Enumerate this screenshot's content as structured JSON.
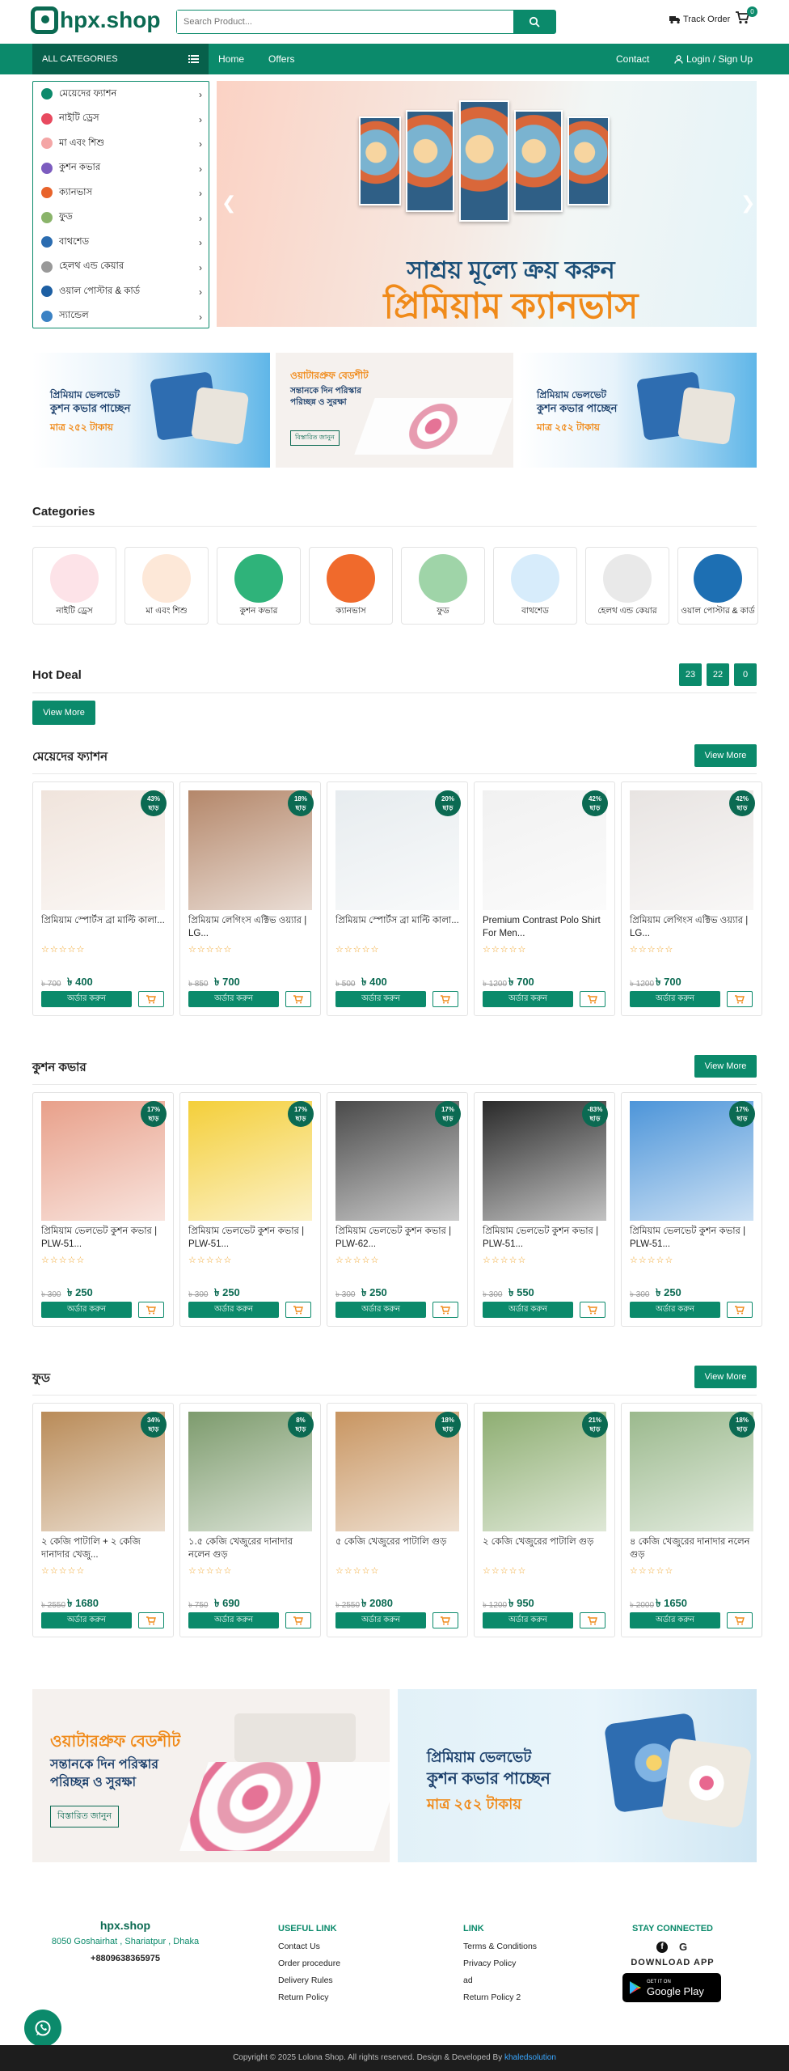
{
  "header": {
    "logo_text": "hpx.shop",
    "search_placeholder": "Search Product...",
    "track_order": "Track Order",
    "cart_count": "0"
  },
  "nav": {
    "all_categories": "ALL CATEGORIES",
    "links": [
      "Home",
      "Offers"
    ],
    "contact": "Contact",
    "login": "Login / Sign Up"
  },
  "sidebar": {
    "items": [
      {
        "label": "মেয়েদের ফ্যাশন",
        "icon": "fashion-icon",
        "color": "#0b8a6b"
      },
      {
        "label": "নাইটি ড্রেস",
        "icon": "dress-icon",
        "color": "#e84a5f"
      },
      {
        "label": "মা এবং শিশু",
        "icon": "baby-icon",
        "color": "#f4a6a6"
      },
      {
        "label": "কুশন কভার",
        "icon": "cushion-icon",
        "color": "#7c5cbf"
      },
      {
        "label": "ক্যানভাস",
        "icon": "canvas-icon",
        "color": "#e8632b"
      },
      {
        "label": "ফুড",
        "icon": "food-icon",
        "color": "#8ab46a"
      },
      {
        "label": "বাথশেড",
        "icon": "bath-icon",
        "color": "#2b6cb0"
      },
      {
        "label": "হেলথ এন্ড কেয়ার",
        "icon": "health-icon",
        "color": "#999999"
      },
      {
        "label": "ওয়াল পোস্টার & কার্ড",
        "icon": "poster-icon",
        "color": "#1d5fa3"
      },
      {
        "label": "স্যান্ডেল",
        "icon": "sandal-icon",
        "color": "#3b82c4"
      }
    ]
  },
  "hero": {
    "line1": "সাশ্রয় মূল্যে ক্রয় করুন",
    "line2": "প্রিমিয়াম ক্যানভাস"
  },
  "promos": [
    {
      "line1": "প্রিমিয়াম ভেলভেট",
      "line2": "কুশন কভার পাচ্ছেন",
      "line3": "মাত্র ২৫২ টাকায়"
    },
    {
      "line1": "ওয়াটারপ্রুফ বেডশীট",
      "line2": "সন্তানকে দিন পরিস্কার",
      "line3": "পরিচ্ছন্ন ও সুরক্ষা",
      "button": "বিস্তারিত জানুন"
    },
    {
      "line1": "প্রিমিয়াম ভেলভেট",
      "line2": "কুশন কভার পাচ্ছেন",
      "line3": "মাত্র ২৫২ টাকায়"
    }
  ],
  "categories": {
    "title": "Categories",
    "items": [
      {
        "label": "নাইটি ড্রেস",
        "color": "#fde3e8"
      },
      {
        "label": "মা এবং শিশু",
        "color": "#fde8d8"
      },
      {
        "label": "কুশন কভার",
        "color": "#2fb37a"
      },
      {
        "label": "ক্যানভাস",
        "color": "#f06a2c"
      },
      {
        "label": "ফুড",
        "color": "#9fd4a8"
      },
      {
        "label": "বাথশেড",
        "color": "#d7ecfb"
      },
      {
        "label": "হেলথ এন্ড কেয়ার",
        "color": "#e9e9e9"
      },
      {
        "label": "ওয়াল পোস্টার & কার্ড",
        "color": "#1d6fb3"
      }
    ]
  },
  "hot_deal": {
    "title": "Hot Deal",
    "countdown": [
      "23",
      "22",
      "0"
    ],
    "view_more": "View More"
  },
  "sections": [
    {
      "title": "মেয়েদের ফ্যাশন",
      "view_more": "View More",
      "products": [
        {
          "name": "প্রিমিয়াম স্পোর্টস ব্রা মাল্টি কালা...",
          "old": "৳ 700",
          "price": "৳ 400",
          "disc": "43%",
          "color": "#f0e4dc"
        },
        {
          "name": "প্রিমিয়াম লেগিংস এক্টিভ ওয়্যার | LG...",
          "old": "৳ 850",
          "price": "৳ 700",
          "disc": "18%",
          "color": "#b4876a"
        },
        {
          "name": "প্রিমিয়াম স্পোর্টস ব্রা মাল্টি কালা...",
          "old": "৳ 500",
          "price": "৳ 400",
          "disc": "20%",
          "color": "#e7ecef"
        },
        {
          "name": "Premium Contrast Polo Shirt For Men...",
          "old": "৳ 1200",
          "price": "৳ 700",
          "disc": "42%",
          "color": "#f1f1f1"
        },
        {
          "name": "প্রিমিয়াম লেগিংস এক্টিভ ওয়্যার | LG...",
          "old": "৳ 1200",
          "price": "৳ 700",
          "disc": "42%",
          "color": "#e8e4e2"
        }
      ]
    },
    {
      "title": "কুশন কভার",
      "view_more": "View More",
      "products": [
        {
          "name": "প্রিমিয়াম ভেলভেট কুশন কভার | PLW-51...",
          "old": "৳ 300",
          "price": "৳ 250",
          "disc": "17%",
          "color": "#e8a08a"
        },
        {
          "name": "প্রিমিয়াম ভেলভেট কুশন কভার | PLW-51...",
          "old": "৳ 300",
          "price": "৳ 250",
          "disc": "17%",
          "color": "#f4cf3a"
        },
        {
          "name": "প্রিমিয়াম ভেলভেট কুশন কভার | PLW-62...",
          "old": "৳ 300",
          "price": "৳ 250",
          "disc": "17%",
          "color": "#4a4a4a"
        },
        {
          "name": "প্রিমিয়াম ভেলভেট কুশন কভার | PLW-51...",
          "old": "৳ 300",
          "price": "৳ 550",
          "disc": "-83%",
          "color": "#2a2a2a"
        },
        {
          "name": "প্রিমিয়াম ভেলভেট কুশন কভার | PLW-51...",
          "old": "৳ 300",
          "price": "৳ 250",
          "disc": "17%",
          "color": "#4d95d9"
        }
      ]
    },
    {
      "title": "ফুড",
      "view_more": "View More",
      "products": [
        {
          "name": "২ কেজি পাটালি + ২ কেজি দানাদার খেজু...",
          "old": "৳ 2550",
          "price": "৳ 1680",
          "disc": "34%",
          "color": "#b98b58"
        },
        {
          "name": "১.৫ কেজি খেজুরের দানাদার নলেন গুড়",
          "old": "৳ 750",
          "price": "৳ 690",
          "disc": "8%",
          "color": "#7d9b6d"
        },
        {
          "name": "৫ কেজি খেজুরের পাটালি গুড়",
          "old": "৳ 2550",
          "price": "৳ 2080",
          "disc": "18%",
          "color": "#c89561"
        },
        {
          "name": "২ কেজি খেজুরের পাটালি গুড়",
          "old": "৳ 1200",
          "price": "৳ 950",
          "disc": "21%",
          "color": "#8eae72"
        },
        {
          "name": "৪ কেজি খেজুরের দানাদার নলেন গুড়",
          "old": "৳ 2000",
          "price": "৳ 1650",
          "disc": "18%",
          "color": "#9bb98d"
        }
      ]
    }
  ],
  "product_buttons": {
    "order": "অর্ডার করুন"
  },
  "bottom_banners": [
    {
      "line1": "ওয়াটারপ্রুফ বেডশীট",
      "line2": "সন্তানকে দিন পরিস্কার",
      "line3": "পরিচ্ছন্ন ও সুরক্ষা",
      "button": "বিস্তারিত জানুন"
    },
    {
      "line1": "প্রিমিয়াম ভেলভেট",
      "line2": "কুশন কভার পাচ্ছেন",
      "line3": "মাত্র ২৫২ টাকায়"
    }
  ],
  "footer": {
    "logo": "hpx.shop",
    "address": "8050 Goshairhat , Shariatpur , Dhaka",
    "phone": "+8809638365975",
    "useful_title": "USEFUL LINK",
    "useful_links": [
      "Contact Us",
      "Order procedure",
      "Delivery Rules",
      "Return Policy"
    ],
    "link_title": "LINK",
    "links": [
      "Terms & Conditions",
      "Privacy Policy",
      "ad",
      "Return Policy 2"
    ],
    "stay_title": "STAY CONNECTED",
    "download": "DOWNLOAD APP",
    "store_small": "GET IT ON",
    "store_big": "Google Play",
    "copyright": "Copyright © 2025 Lolona Shop. All rights reserved. Design & Developed By",
    "developer": "khaledsolution"
  }
}
